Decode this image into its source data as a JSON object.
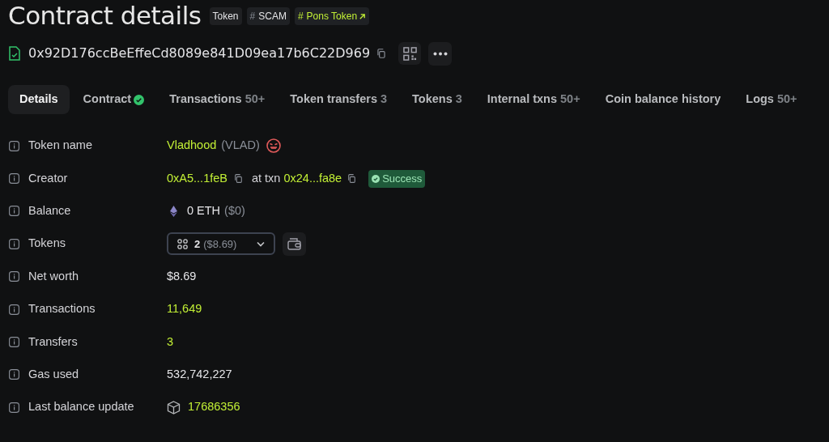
{
  "title": "Contract details",
  "tags": [
    {
      "label": "Token",
      "kind": "plain"
    },
    {
      "prefix": "#",
      "label": "SCAM",
      "kind": "hash"
    },
    {
      "prefix": "#",
      "label": "Pons Token",
      "kind": "link"
    }
  ],
  "address": "0x92D176ccBeEffeCd8089e841D09ea17b6C22D969",
  "tabs": [
    {
      "label": "Details",
      "selected": true,
      "verified": false
    },
    {
      "label": "Contract",
      "selected": false,
      "verified": true
    },
    {
      "label": "Transactions",
      "count": "50+",
      "selected": false,
      "verified": false
    },
    {
      "label": "Token transfers",
      "count": "3",
      "selected": false,
      "verified": false
    },
    {
      "label": "Tokens",
      "count": "3",
      "selected": false,
      "verified": false
    },
    {
      "label": "Internal txns",
      "count": "50+",
      "selected": false,
      "verified": false
    },
    {
      "label": "Coin balance history",
      "selected": false,
      "verified": false
    },
    {
      "label": "Logs",
      "count": "50+",
      "selected": false,
      "verified": false
    }
  ],
  "rows": [
    {
      "label": "Token name",
      "kind": "token",
      "name": "Vladhood",
      "symbol": "(VLAD)"
    },
    {
      "label": "Creator",
      "kind": "creator",
      "address": "0xA5...1feB",
      "connector": "at txn",
      "txn": "0x24...fa8e",
      "status": "Success"
    },
    {
      "label": "Balance",
      "kind": "balance",
      "amount": "0 ETH",
      "fiat": "($0)"
    },
    {
      "label": "Tokens",
      "kind": "tokens",
      "count": "2",
      "fiat": "($8.69)"
    },
    {
      "label": "Net worth",
      "kind": "text",
      "value": "$8.69"
    },
    {
      "label": "Transactions",
      "kind": "link",
      "value": "11,649"
    },
    {
      "label": "Transfers",
      "kind": "link",
      "value": "3"
    },
    {
      "label": "Gas used",
      "kind": "text",
      "value": "532,742,227"
    },
    {
      "label": "Last balance update",
      "kind": "block",
      "value": "17686356"
    }
  ]
}
